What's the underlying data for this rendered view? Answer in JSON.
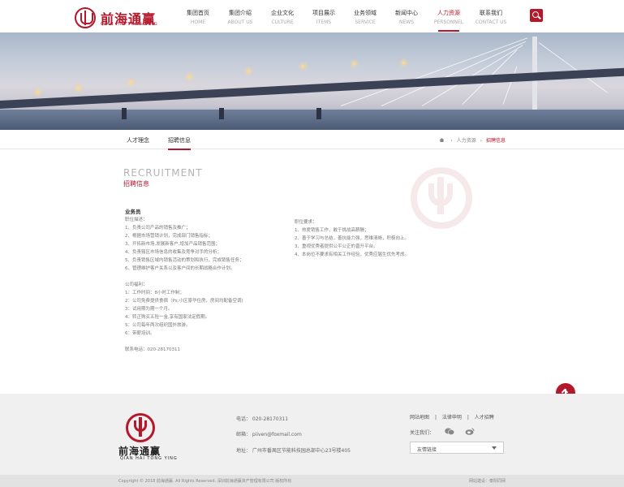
{
  "logo": {
    "cn": "前海通赢",
    "en": "QIAN HAI TONG YING"
  },
  "nav": [
    {
      "cn": "集团首页",
      "en": "HOME",
      "active": false
    },
    {
      "cn": "集团介绍",
      "en": "ABOUT US",
      "active": false
    },
    {
      "cn": "企业文化",
      "en": "CULTURE",
      "active": false
    },
    {
      "cn": "项目展示",
      "en": "ITEMS",
      "active": false
    },
    {
      "cn": "业务领域",
      "en": "SERVICE",
      "active": false
    },
    {
      "cn": "新闻中心",
      "en": "NEWS",
      "active": false
    },
    {
      "cn": "人力资源",
      "en": "PERSONNEL",
      "active": true
    },
    {
      "cn": "联系我们",
      "en": "CONTACT US",
      "active": false
    }
  ],
  "subnav": {
    "tabs": [
      "人才理念",
      "招聘信息"
    ],
    "active_index": 1
  },
  "breadcrumb": {
    "section": "人力资源",
    "current": "招聘信息"
  },
  "recruit": {
    "title_en": "RECRUITMENT",
    "title_cn": "招聘信息"
  },
  "job": {
    "title": "业务员",
    "duties_heading": "职位描述：",
    "duties": [
      "1、负责公司产品的销售及推广；",
      "2、根据市场营销计划，完成部门销售指标；",
      "3、开拓新市场,发展新客户,增加产品销售范围；",
      "4、负责辖区市场信息的收集及竞争对手的分析；",
      "5、负责销售区域内销售活动的策划和执行，完成销售任务；",
      "6、管理维护客户关系以及客户间的长期战略合作计划。"
    ],
    "benefits_heading": "公司福利：",
    "benefits": [
      "1：工作时间：8小时工作制；",
      "2：公司免费提供食宿（Ps:小区豪华住房，房间均配备空调)",
      "3：试用期为期一个月。",
      "4：转正购买五险一金,享有国家法定假期。",
      "5：公司每年两次组织国外旅游。",
      "6：带薪培训。"
    ],
    "contact": "联系电话：020-28170311",
    "req_heading": "职位要求：",
    "requirements": [
      "1、热爱销售工作，敢于挑战高薪酬；",
      "2、善于学习与总结，善抗能力强，思维清晰，积极向上。",
      "3、重视优秀者提供公平公正的晋升平台。",
      "4、本岗位不要求有相关工作经验，优秀应届生优先考虑。"
    ]
  },
  "footer": {
    "logo_cn": "前海通赢",
    "logo_en": "QIAN HAI TONG YING",
    "phone": "电话：  020-28170311",
    "email": "邮箱：  piiven@foxmail.com",
    "address": "地址：  广州市番禺区节能科技园总部中心23号楼405",
    "links": [
      "网站地图",
      "法律申明",
      "人才招聘"
    ],
    "follow": "关注我们：",
    "select_label": "友情链接"
  },
  "copyright": {
    "left": "Copyright © 2018 前海通赢. All Rights Reserved. 深圳前海通赢资产管理有限公司 版权所有",
    "right": "网站建设：泰阳同网"
  },
  "colors": {
    "brand": "#b5182a"
  }
}
